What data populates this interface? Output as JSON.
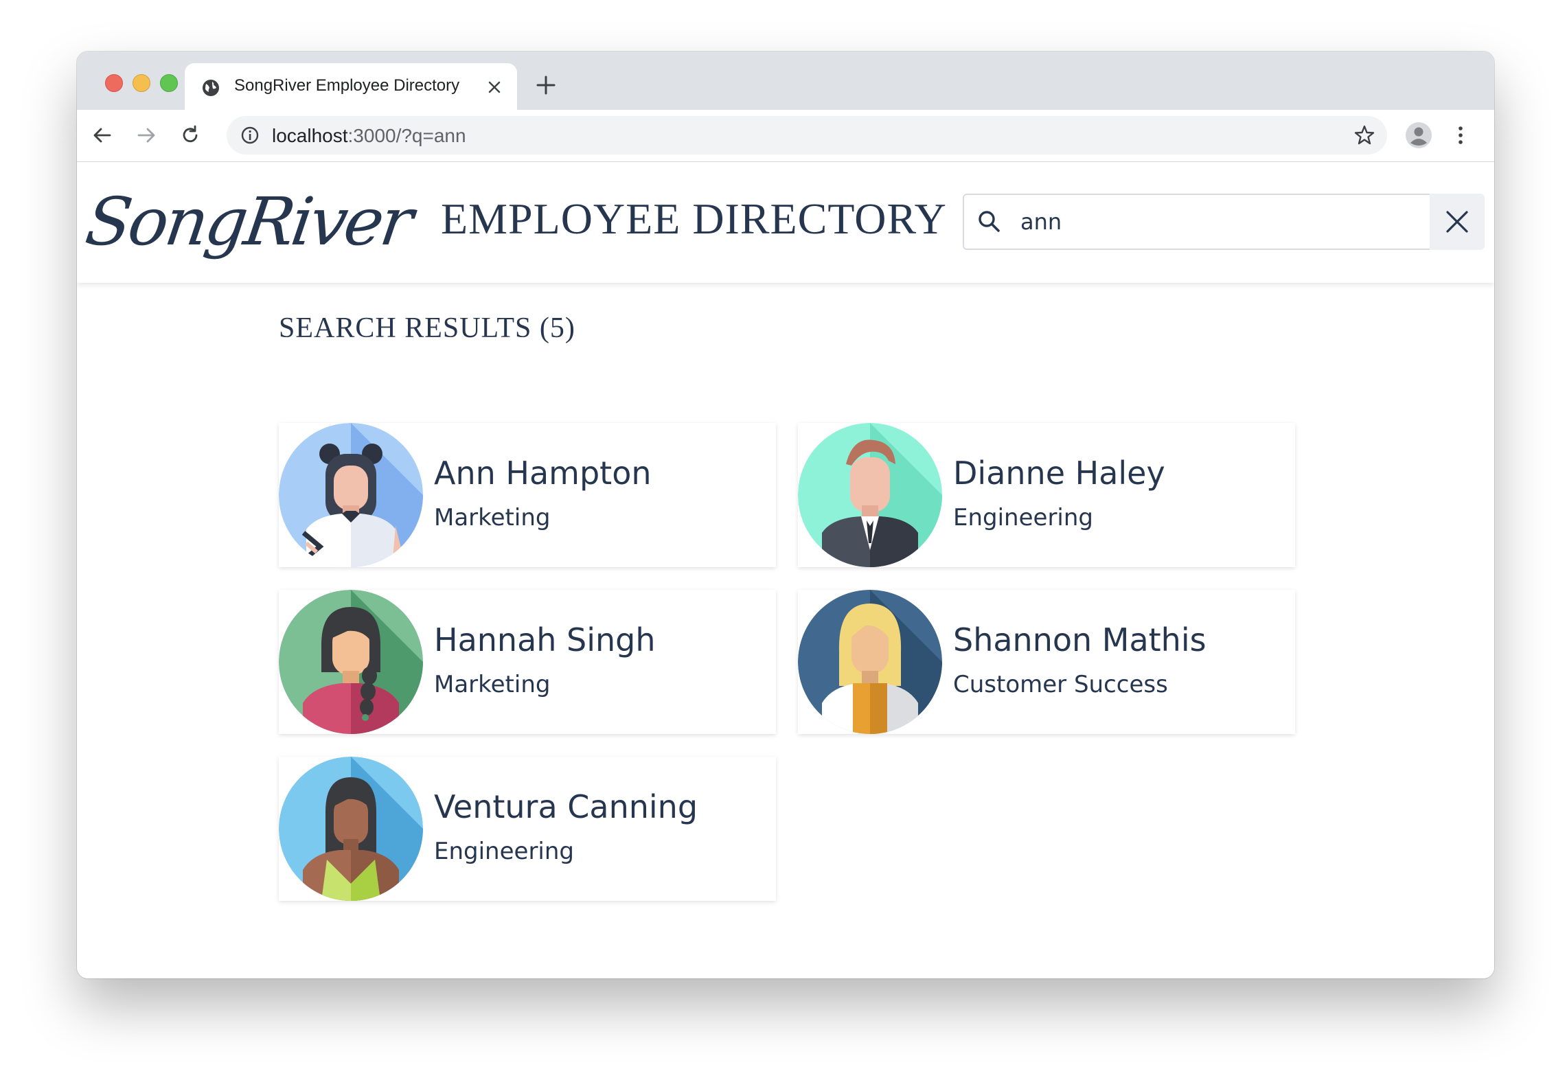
{
  "browser": {
    "tab_title": "SongRiver Employee Directory",
    "url_host": "localhost",
    "url_rest": ":3000/?q=ann"
  },
  "header": {
    "logo_text": "SongRiver",
    "title": "EMPLOYEE DIRECTORY",
    "search_value": "ann"
  },
  "results": {
    "title": "SEARCH RESULTS (5)",
    "employees": [
      {
        "name": "Ann Hampton",
        "department": "Marketing",
        "avatar": "woman-buns-avatar"
      },
      {
        "name": "Dianne Haley",
        "department": "Engineering",
        "avatar": "man-suit-avatar"
      },
      {
        "name": "Hannah Singh",
        "department": "Marketing",
        "avatar": "woman-braid-avatar"
      },
      {
        "name": "Shannon Mathis",
        "department": "Customer Success",
        "avatar": "woman-blonde-avatar"
      },
      {
        "name": "Ventura Canning",
        "department": "Engineering",
        "avatar": "woman-long-hair-avatar"
      }
    ]
  },
  "colors": {
    "text": "#27364f",
    "tabbar": "#dee1e6",
    "omnibox": "#f1f3f4"
  }
}
